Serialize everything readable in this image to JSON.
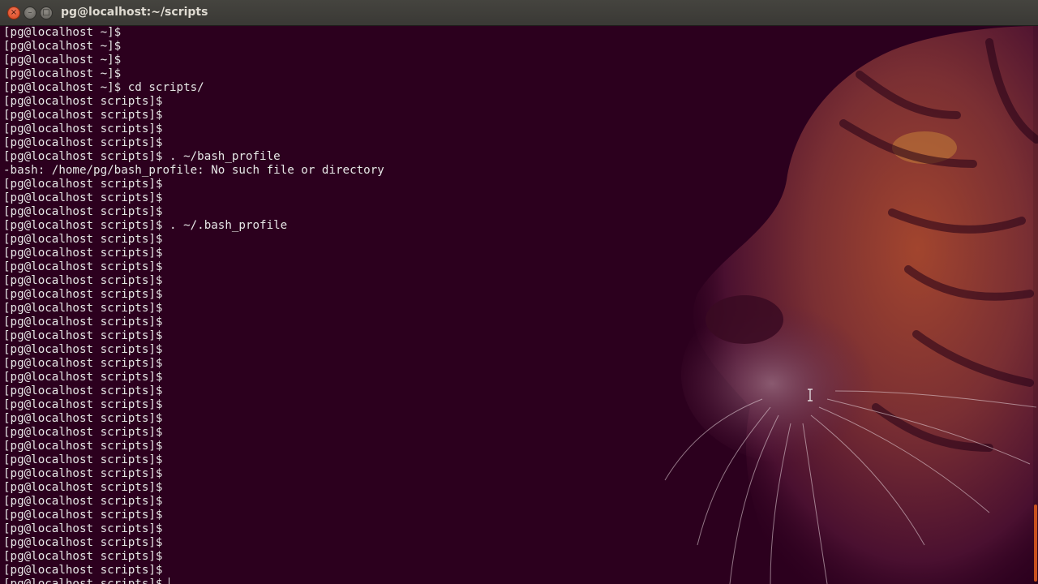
{
  "window": {
    "title": "pg@localhost:~/scripts",
    "buttons": {
      "close_glyph": "×",
      "minimize_glyph": "–",
      "maximize_glyph": "□"
    }
  },
  "terminal": {
    "lines": [
      "[pg@localhost ~]$",
      "[pg@localhost ~]$",
      "[pg@localhost ~]$",
      "[pg@localhost ~]$",
      "[pg@localhost ~]$ cd scripts/",
      "[pg@localhost scripts]$",
      "[pg@localhost scripts]$",
      "[pg@localhost scripts]$",
      "[pg@localhost scripts]$",
      "[pg@localhost scripts]$ . ~/bash_profile",
      "-bash: /home/pg/bash_profile: No such file or directory",
      "[pg@localhost scripts]$",
      "[pg@localhost scripts]$",
      "[pg@localhost scripts]$",
      "[pg@localhost scripts]$ . ~/.bash_profile",
      "[pg@localhost scripts]$",
      "[pg@localhost scripts]$",
      "[pg@localhost scripts]$",
      "[pg@localhost scripts]$",
      "[pg@localhost scripts]$",
      "[pg@localhost scripts]$",
      "[pg@localhost scripts]$",
      "[pg@localhost scripts]$",
      "[pg@localhost scripts]$",
      "[pg@localhost scripts]$",
      "[pg@localhost scripts]$",
      "[pg@localhost scripts]$",
      "[pg@localhost scripts]$",
      "[pg@localhost scripts]$",
      "[pg@localhost scripts]$",
      "[pg@localhost scripts]$",
      "[pg@localhost scripts]$",
      "[pg@localhost scripts]$",
      "[pg@localhost scripts]$",
      "[pg@localhost scripts]$",
      "[pg@localhost scripts]$",
      "[pg@localhost scripts]$",
      "[pg@localhost scripts]$",
      "[pg@localhost scripts]$",
      "[pg@localhost scripts]$",
      "[pg@localhost scripts]$"
    ],
    "background_color": "#2c001e",
    "text_color": "#e6e6e6",
    "wallpaper_icon": "tiger-face-icon",
    "pointer_icon": "ibeam-cursor-icon"
  },
  "theme": {
    "titlebar_color": "#3e3d39",
    "close_button_color": "#e5582c",
    "scrollbar_thumb_color": "#c9521f"
  }
}
